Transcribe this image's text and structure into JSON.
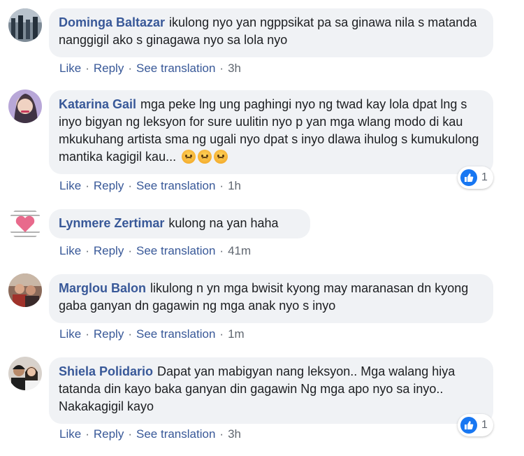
{
  "actions": {
    "like": "Like",
    "reply": "Reply",
    "see_translation": "See translation",
    "separator": "·"
  },
  "comments": [
    {
      "name": "Dominga Baltazar",
      "text": "ikulong nyo yan ngppsikat pa sa ginawa nila s matanda nanggigil ako s ginagawa nyo sa lola nyo",
      "time": "3h"
    },
    {
      "name": "Katarina Gail",
      "text": "mga peke lng ung paghingi nyo ng twad kay lola dpat lng s inyo bigyan ng leksyon for sure uulitin nyo p yan mga wlang modo di kau mkukuhang artista sma ng ugali nyo dpat s inyo dlawa ihulog s kumukulong mantika kagigil kau...",
      "time": "1h",
      "reactions": "1",
      "emoji": "angry-face-icon"
    },
    {
      "name": "Lynmere Zertimar",
      "text": "kulong na yan haha",
      "time": "41m"
    },
    {
      "name": "Marglou Balon",
      "text": "likulong n yn mga bwisit kyong may maranasan dn kyong gaba ganyan dn gagawin ng mga anak nyo s inyo",
      "time": "1m"
    },
    {
      "name": "Shiela Polidario",
      "text": "Dapat yan mabigyan nang leksyon.. Mga walang hiya tatanda din kayo baka ganyan din gagawin Ng mga apo nyo sa inyo.. Nakakagigil kayo",
      "time": "3h",
      "reactions": "1"
    }
  ],
  "colors": {
    "name": "#385898",
    "bubble": "#f0f2f5",
    "like_blue": "#1877f2",
    "meta": "#606770"
  }
}
